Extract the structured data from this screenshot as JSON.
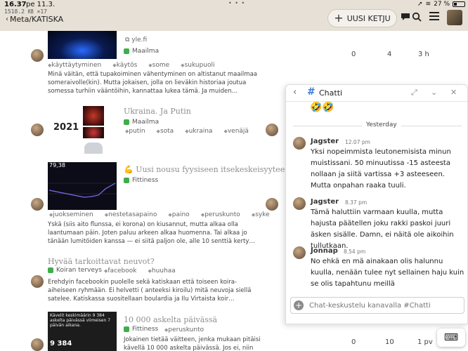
{
  "status_bar": {
    "time": "16.37",
    "date": "pe 11.3.",
    "speed": "1518.2 ㎅ ×17",
    "dots": "• • •",
    "battery_percent": "27 %"
  },
  "header": {
    "breadcrumb": "Meta/KATISKA",
    "new_topic_label": "UUSI KETJU"
  },
  "topics": [
    {
      "domain": "yle.fi",
      "category": "Maailma",
      "tags": [
        "käyttäytyminen",
        "käytös",
        "some",
        "sukupuoli"
      ],
      "excerpt": "Minä väitän, että tupakoiminen vähentyminen on altistanut maailmaa someraivolle(kin). Mutta jokaisen, jolla on lieväkin historiaa joutua somessa turhiin vääntöihin, kannattaa lukea tämä. Ja muiden…",
      "replies": "0",
      "views": "4",
      "activity": "3 h"
    },
    {
      "title": "Ukraina. Ja Putin",
      "category": "Maailma",
      "tags": [
        "putin",
        "sota",
        "ukraina",
        "venäjä"
      ],
      "thumb_year": "2021"
    },
    {
      "title": "Uusi nousu fyysiseen itsekeskeisyyteen",
      "category": "Fittiness",
      "tags": [
        "juokseminen",
        "nestetasapaino",
        "paino",
        "peruskunto",
        "syke"
      ],
      "thumb_value": "79,38",
      "excerpt": "Yskä (siis aito flunssa, ei korona) on kiusannut, mutta alkaa olla laantumaan päin. Joten paluu arkeen alkaa huomenna. Tai alkaa jo tänään lumitöiden kanssa — ei siitä paljon ole, alle 10 senttiä kerty…"
    },
    {
      "title": "Hyvää tarkoittavat neuvot?",
      "category": "Koiran terveys",
      "tags": [
        "facebook",
        "huuhaa"
      ],
      "excerpt": "Erehdyin facebookin puolelle sekä katiskaan että toiseen koira-aiheiseen ryhmään. Ei helvetti ( anteeksi kiroilu) mitä neuvoja siellä satelee. Katiskassa suositellaan boulardia ja Ilu Virtaista koir…"
    },
    {
      "title": "10 000 askelta päivässä",
      "category": "Fittiness",
      "tags": [
        "peruskunto"
      ],
      "thumb_text": "Kävelit keskimäärin 9 384 askelta päivässä viimeisen 7 päivän aikana.",
      "thumb_value": "9 384",
      "excerpt": "Jokainen tietää väitteen, jenka mukaan pitäisi kävellä 10 000 askelta päivässä. Jos ei, niin kunto",
      "replies": "0",
      "views": "10",
      "activity": "1 pv"
    }
  ],
  "chat": {
    "title": "Chatti",
    "emojis": "🤣🤣",
    "divider": "Yesterday",
    "messages": [
      {
        "name": "Jagster",
        "time": "12.07 pm",
        "text": "Yksi nopeimmista leutonemisista minun muistissani. 50 minuutissa -15 asteesta nollaan ja siitä vartissa +3 asteeseen. Mutta onpahan raaka tuuli."
      },
      {
        "name": "Jagster",
        "time": "8.37 pm",
        "text": "Tämä haluttiin varmaan kuulla, mutta hajusta päätellen joku rakki paskoi juuri äsken sisälle. Damn, ei näitä ole aikoihin tullutkaan."
      },
      {
        "name": "Jonnap",
        "time": "8.54 pm",
        "text": "No ehkä en mä ainakaan olis halunnu kuulla, nenään tulee nyt sellainen haju kuin se olis tapahtunu meillä"
      }
    ],
    "composer_placeholder": "Chat-keskustelu kanavalla #Chatti"
  },
  "colors": {
    "header_bg": "#e6e0d6",
    "category_green": "#3fae4a",
    "chat_hash": "#3a7bd5"
  }
}
